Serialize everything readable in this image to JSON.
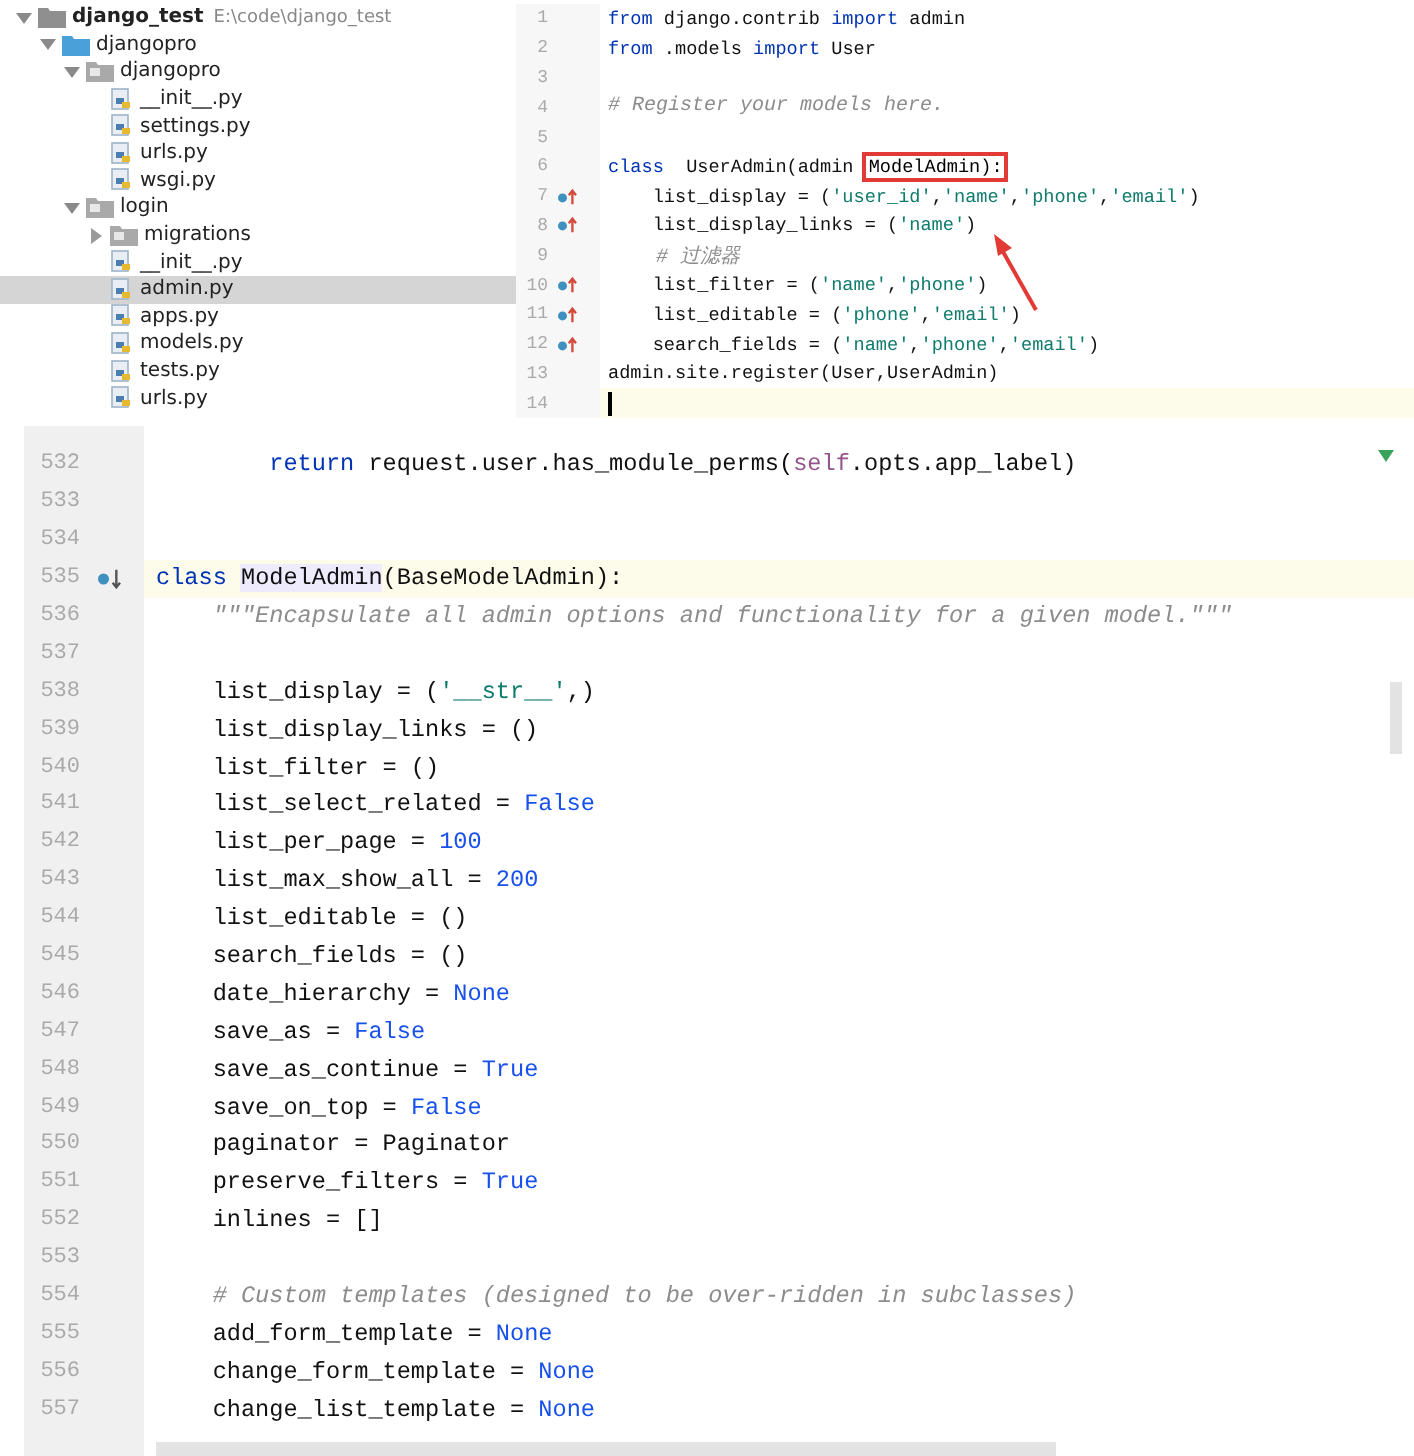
{
  "project_tree": [
    {
      "label": "django_test",
      "kind": "project",
      "path": "E:\\code\\django_test",
      "expanded": true,
      "selected": false,
      "children": [
        {
          "label": "djangopro",
          "kind": "module",
          "expanded": true,
          "selected": false,
          "children": [
            {
              "label": "djangopro",
              "kind": "folder",
              "expanded": true,
              "selected": false,
              "children": [
                {
                  "label": "__init__.py",
                  "kind": "file",
                  "selected": false
                },
                {
                  "label": "settings.py",
                  "kind": "file",
                  "selected": false
                },
                {
                  "label": "urls.py",
                  "kind": "file",
                  "selected": false
                },
                {
                  "label": "wsgi.py",
                  "kind": "file",
                  "selected": false
                }
              ]
            },
            {
              "label": "login",
              "kind": "folder",
              "expanded": true,
              "selected": false,
              "children": [
                {
                  "label": "migrations",
                  "kind": "folder",
                  "expanded": false,
                  "selected": false
                },
                {
                  "label": "__init__.py",
                  "kind": "file",
                  "selected": false
                },
                {
                  "label": "admin.py",
                  "kind": "file",
                  "selected": true
                },
                {
                  "label": "apps.py",
                  "kind": "file",
                  "selected": false
                },
                {
                  "label": "models.py",
                  "kind": "file",
                  "selected": false
                },
                {
                  "label": "tests.py",
                  "kind": "file",
                  "selected": false
                },
                {
                  "label": "urls.py",
                  "kind": "file",
                  "selected": false
                }
              ]
            }
          ]
        }
      ]
    }
  ],
  "admin_editor": {
    "lines": [
      {
        "number": "1",
        "kind": "plain",
        "current": false,
        "tokens": [
          {
            "kind": "kw",
            "text": "from"
          },
          {
            "kind": "plain",
            "text": " django.contrib "
          },
          {
            "kind": "kw",
            "text": "import"
          },
          {
            "kind": "plain",
            "text": " admin"
          }
        ]
      },
      {
        "number": "2",
        "kind": "plain",
        "current": false,
        "tokens": [
          {
            "kind": "kw",
            "text": "from"
          },
          {
            "kind": "plain",
            "text": " .models "
          },
          {
            "kind": "kw",
            "text": "import"
          },
          {
            "kind": "plain",
            "text": " User"
          }
        ]
      },
      {
        "number": "3",
        "kind": "plain",
        "current": false
      },
      {
        "number": "4",
        "kind": "plain",
        "current": false,
        "tokens": [
          {
            "kind": "com",
            "text": "# Register your models here."
          }
        ]
      },
      {
        "number": "5",
        "kind": "plain",
        "current": false
      },
      {
        "number": "6",
        "kind": "plain",
        "current": false,
        "tokens": [
          {
            "kind": "kw",
            "text": "class"
          },
          {
            "kind": "plain",
            "text": "  UserAdmin(admin "
          },
          {
            "kind": "boxed",
            "text": "ModelAdmin):"
          }
        ]
      },
      {
        "number": "7",
        "kind": "override",
        "current": false,
        "tokens": [
          {
            "kind": "plain",
            "text": "    list_display = ("
          },
          {
            "kind": "str",
            "text": "'user_id'"
          },
          {
            "kind": "plain",
            "text": ","
          },
          {
            "kind": "str",
            "text": "'name'"
          },
          {
            "kind": "plain",
            "text": ","
          },
          {
            "kind": "str",
            "text": "'phone'"
          },
          {
            "kind": "plain",
            "text": ","
          },
          {
            "kind": "str",
            "text": "'email'"
          },
          {
            "kind": "plain",
            "text": ")"
          }
        ]
      },
      {
        "number": "8",
        "kind": "override",
        "current": false,
        "tokens": [
          {
            "kind": "plain",
            "text": "    list_display_links = ("
          },
          {
            "kind": "str",
            "text": "'name'"
          },
          {
            "kind": "plain",
            "text": ")"
          }
        ]
      },
      {
        "number": "9",
        "kind": "plain",
        "current": false,
        "tokens": [
          {
            "kind": "com",
            "text": "    # 过滤器"
          }
        ]
      },
      {
        "number": "10",
        "kind": "override",
        "current": false,
        "tokens": [
          {
            "kind": "plain",
            "text": "    list_filter = ("
          },
          {
            "kind": "str",
            "text": "'name'"
          },
          {
            "kind": "plain",
            "text": ","
          },
          {
            "kind": "str",
            "text": "'phone'"
          },
          {
            "kind": "plain",
            "text": ")"
          }
        ]
      },
      {
        "number": "11",
        "kind": "override",
        "current": false,
        "tokens": [
          {
            "kind": "plain",
            "text": "    list_editable = ("
          },
          {
            "kind": "str",
            "text": "'phone'"
          },
          {
            "kind": "plain",
            "text": ","
          },
          {
            "kind": "str",
            "text": "'email'"
          },
          {
            "kind": "plain",
            "text": ")"
          }
        ]
      },
      {
        "number": "12",
        "kind": "override",
        "current": false,
        "tokens": [
          {
            "kind": "plain",
            "text": "    search_fields = ("
          },
          {
            "kind": "str",
            "text": "'name'"
          },
          {
            "kind": "plain",
            "text": ","
          },
          {
            "kind": "str",
            "text": "'phone'"
          },
          {
            "kind": "plain",
            "text": ","
          },
          {
            "kind": "str",
            "text": "'email'"
          },
          {
            "kind": "plain",
            "text": ")"
          }
        ]
      },
      {
        "number": "13",
        "kind": "plain",
        "current": false,
        "tokens": [
          {
            "kind": "plain",
            "text": "admin.site.register(User,UserAdmin)"
          }
        ]
      },
      {
        "number": "14",
        "kind": "plain",
        "current": true
      }
    ]
  },
  "options_editor": {
    "lines": [
      {
        "number": "532",
        "kind": "plain",
        "current": false,
        "tokens": [
          {
            "kind": "kw",
            "text": "        return"
          },
          {
            "kind": "plain",
            "text": " request.user.has_module_perms("
          },
          {
            "kind": "self",
            "text": "self"
          },
          {
            "kind": "plain",
            "text": ".opts.app_label)"
          }
        ]
      },
      {
        "number": "533",
        "kind": "plain",
        "current": false
      },
      {
        "number": "534",
        "kind": "plain",
        "current": false
      },
      {
        "number": "535",
        "kind": "implemented",
        "current": true,
        "tokens": [
          {
            "kind": "kw",
            "text": "class "
          },
          {
            "kind": "hl",
            "text": "ModelAdmin"
          },
          {
            "kind": "plain",
            "text": "(BaseModelAdmin):"
          }
        ]
      },
      {
        "number": "536",
        "kind": "plain",
        "current": false,
        "tokens": [
          {
            "kind": "com",
            "text": "    \"\"\"Encapsulate all admin options and functionality for a given model.\"\"\""
          }
        ]
      },
      {
        "number": "537",
        "kind": "plain",
        "current": false
      },
      {
        "number": "538",
        "kind": "plain",
        "current": false,
        "tokens": [
          {
            "kind": "plain",
            "text": "    list_display = ("
          },
          {
            "kind": "str",
            "text": "'__str__'"
          },
          {
            "kind": "plain",
            "text": ",)"
          }
        ]
      },
      {
        "number": "539",
        "kind": "plain",
        "current": false,
        "tokens": [
          {
            "kind": "plain",
            "text": "    list_display_links = ()"
          }
        ]
      },
      {
        "number": "540",
        "kind": "plain",
        "current": false,
        "tokens": [
          {
            "kind": "plain",
            "text": "    list_filter = ()"
          }
        ]
      },
      {
        "number": "541",
        "kind": "plain",
        "current": false,
        "tokens": [
          {
            "kind": "plain",
            "text": "    list_select_related = "
          },
          {
            "kind": "num",
            "text": "False"
          }
        ]
      },
      {
        "number": "542",
        "kind": "plain",
        "current": false,
        "tokens": [
          {
            "kind": "plain",
            "text": "    list_per_page = "
          },
          {
            "kind": "num",
            "text": "100"
          }
        ]
      },
      {
        "number": "543",
        "kind": "plain",
        "current": false,
        "tokens": [
          {
            "kind": "plain",
            "text": "    list_max_show_all = "
          },
          {
            "kind": "num",
            "text": "200"
          }
        ]
      },
      {
        "number": "544",
        "kind": "plain",
        "current": false,
        "tokens": [
          {
            "kind": "plain",
            "text": "    list_editable = ()"
          }
        ]
      },
      {
        "number": "545",
        "kind": "plain",
        "current": false,
        "tokens": [
          {
            "kind": "plain",
            "text": "    search_fields = ()"
          }
        ]
      },
      {
        "number": "546",
        "kind": "plain",
        "current": false,
        "tokens": [
          {
            "kind": "plain",
            "text": "    date_hierarchy = "
          },
          {
            "kind": "num",
            "text": "None"
          }
        ]
      },
      {
        "number": "547",
        "kind": "plain",
        "current": false,
        "tokens": [
          {
            "kind": "plain",
            "text": "    save_as = "
          },
          {
            "kind": "num",
            "text": "False"
          }
        ]
      },
      {
        "number": "548",
        "kind": "plain",
        "current": false,
        "tokens": [
          {
            "kind": "plain",
            "text": "    save_as_continue = "
          },
          {
            "kind": "num",
            "text": "True"
          }
        ]
      },
      {
        "number": "549",
        "kind": "plain",
        "current": false,
        "tokens": [
          {
            "kind": "plain",
            "text": "    save_on_top = "
          },
          {
            "kind": "num",
            "text": "False"
          }
        ]
      },
      {
        "number": "550",
        "kind": "plain",
        "current": false,
        "tokens": [
          {
            "kind": "plain",
            "text": "    paginator = Paginator"
          }
        ]
      },
      {
        "number": "551",
        "kind": "plain",
        "current": false,
        "tokens": [
          {
            "kind": "plain",
            "text": "    preserve_filters = "
          },
          {
            "kind": "num",
            "text": "True"
          }
        ]
      },
      {
        "number": "552",
        "kind": "plain",
        "current": false,
        "tokens": [
          {
            "kind": "plain",
            "text": "    inlines = []"
          }
        ]
      },
      {
        "number": "553",
        "kind": "plain",
        "current": false
      },
      {
        "number": "554",
        "kind": "plain",
        "current": false,
        "tokens": [
          {
            "kind": "com",
            "text": "    # Custom templates (designed to be over-ridden in subclasses)"
          }
        ]
      },
      {
        "number": "555",
        "kind": "plain",
        "current": false,
        "tokens": [
          {
            "kind": "plain",
            "text": "    add_form_template = "
          },
          {
            "kind": "num",
            "text": "None"
          }
        ]
      },
      {
        "number": "556",
        "kind": "plain",
        "current": false,
        "tokens": [
          {
            "kind": "plain",
            "text": "    change_form_template = "
          },
          {
            "kind": "num",
            "text": "None"
          }
        ]
      },
      {
        "number": "557",
        "kind": "plain",
        "current": false,
        "tokens": [
          {
            "kind": "plain",
            "text": "    change_list_template = "
          },
          {
            "kind": "num",
            "text": "None"
          }
        ]
      }
    ]
  }
}
